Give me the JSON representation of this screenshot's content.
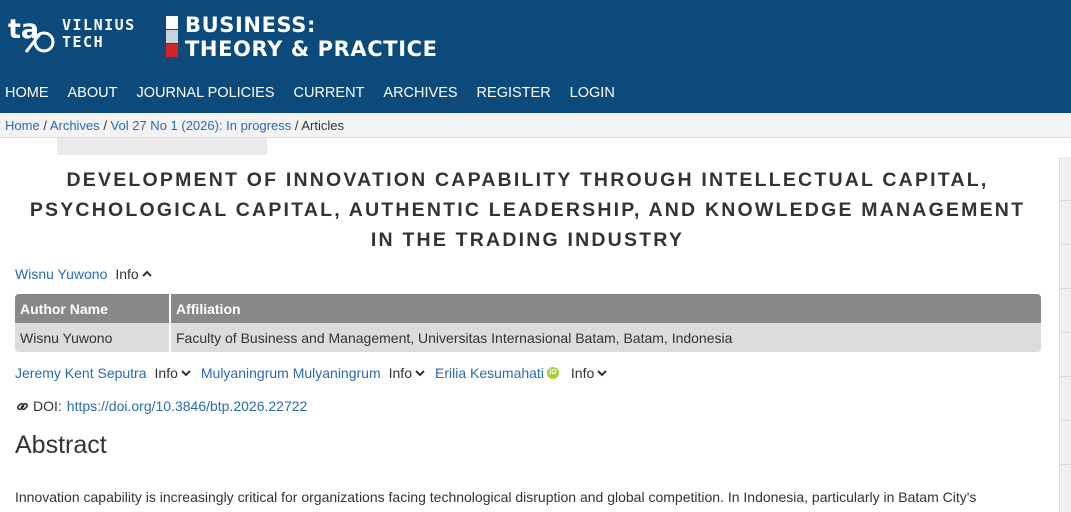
{
  "brand": {
    "publisher_line1": "VILNIUS",
    "publisher_line2": "TECH",
    "journal_line1": "BUSINESS:",
    "journal_line2": "THEORY & PRACTICE",
    "header_color": "#0b4a7a"
  },
  "nav": {
    "items": [
      "HOME",
      "ABOUT",
      "JOURNAL POLICIES",
      "CURRENT",
      "ARCHIVES",
      "REGISTER",
      "LOGIN"
    ]
  },
  "breadcrumb": {
    "home": "Home",
    "archives": "Archives",
    "issue": "Vol 27 No 1 (2026): In progress",
    "current": "Articles"
  },
  "article": {
    "title": "DEVELOPMENT OF INNOVATION CAPABILITY THROUGH INTELLECTUAL CAPITAL, PSYCHOLOGICAL CAPITAL, AUTHENTIC LEADERSHIP, AND KNOWLEDGE MANAGEMENT IN THE TRADING INDUSTRY",
    "first_author": "Wisnu Yuwono",
    "info_label": "Info",
    "affiliation_table": {
      "headers": [
        "Author Name",
        "Affiliation"
      ],
      "rows": [
        [
          "Wisnu Yuwono",
          "Faculty of Business and Management, Universitas Internasional Batam, Batam, Indonesia"
        ]
      ]
    },
    "other_authors": [
      "Jeremy Kent Seputra",
      "Mulyaningrum Mulyaningrum",
      "Erilia Kesumahati"
    ],
    "doi_label": "DOI:",
    "doi_url": "https://doi.org/10.3846/btp.2026.22722",
    "abstract_heading": "Abstract",
    "abstract_text": "Innovation capability is increasingly critical for organizations facing technological disruption and global competition. In Indonesia, particularly in Batam City's"
  },
  "icons": {
    "chevron_up": "chevron-up-icon",
    "chevron_down": "chevron-down-icon",
    "orcid": "orcid-icon",
    "link": "link-icon"
  },
  "colors": {
    "link": "#2a6ab4",
    "table_header": "#888888",
    "table_row": "#dcdcdc",
    "accent_red": "#d6202a"
  }
}
